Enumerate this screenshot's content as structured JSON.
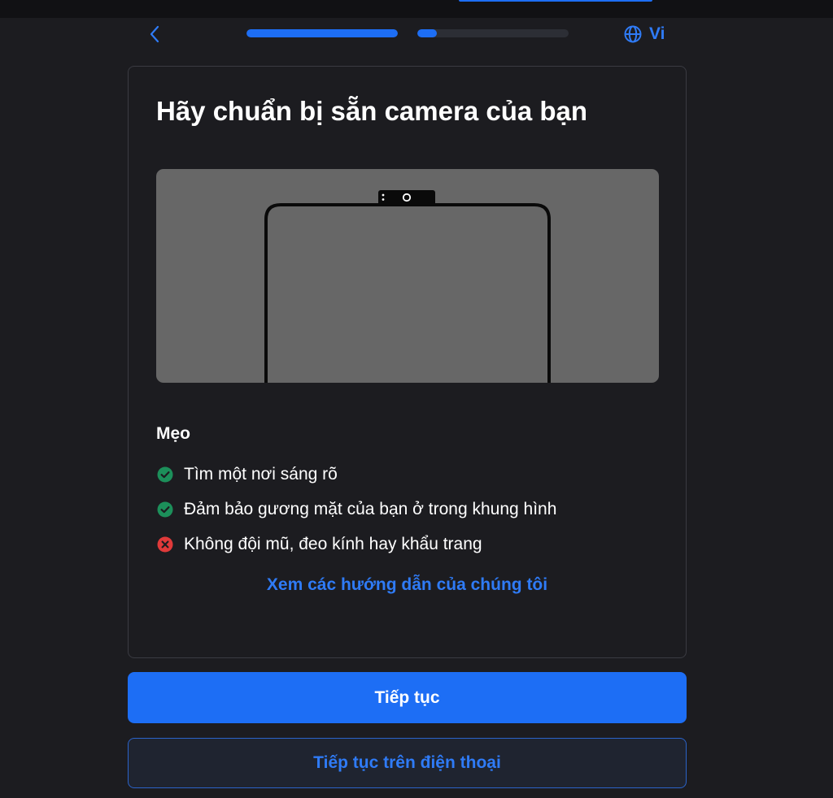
{
  "header": {
    "language_label": "Vi",
    "progress": [
      {
        "step": 1,
        "fraction": 1.0
      },
      {
        "step": 2,
        "fraction": 0.13
      }
    ]
  },
  "card": {
    "title": "Hãy chuẩn bị sẵn camera của bạn",
    "tips_title": "Mẹo",
    "tips": [
      {
        "text": "Tìm một nơi sáng rõ",
        "status": "do",
        "icon": "check-circle-icon"
      },
      {
        "text": "Đảm bảo gương mặt của bạn ở trong khung hình",
        "status": "do",
        "icon": "check-circle-icon"
      },
      {
        "text": "Không đội mũ, đeo kính hay khẩu trang",
        "status": "dont",
        "icon": "x-circle-icon"
      }
    ],
    "guide_link": "Xem các hướng dẫn của chúng tôi"
  },
  "actions": {
    "continue_label": "Tiếp tục",
    "continue_on_phone_label": "Tiếp tục trên điện thoại"
  },
  "colors": {
    "accent": "#1d6ef5",
    "link": "#2f7bf6",
    "success": "#1c8f5a",
    "danger": "#e03a3a",
    "background": "#1c1c20"
  }
}
